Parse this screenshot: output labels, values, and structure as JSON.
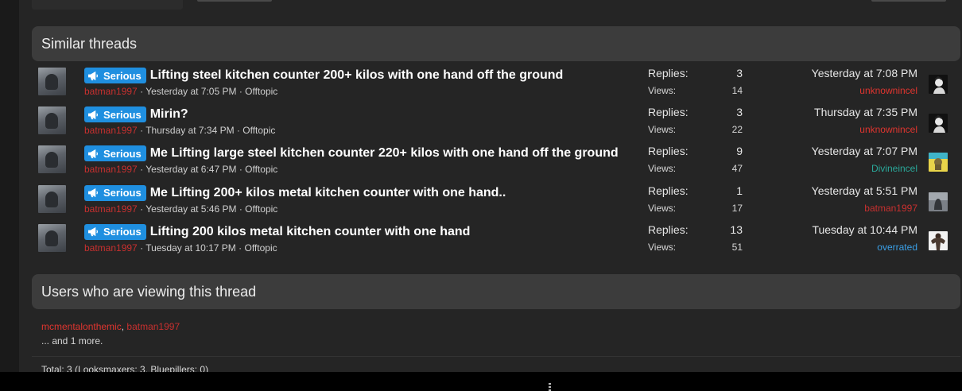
{
  "similar": {
    "heading": "Similar threads",
    "threads": [
      {
        "prefix": "Serious",
        "title": "Lifting steel kitchen counter 200+ kilos with one hand off the ground",
        "author": "batman1997",
        "when": "Yesterday at 7:05 PM",
        "forum": "Offtopic",
        "replies_label": "Replies:",
        "replies": "3",
        "views_label": "Views:",
        "views": "14",
        "last_date": "Yesterday at 7:08 PM",
        "last_user": "unknownincel",
        "last_user_color": "#e0352f",
        "last_avatar": "dark"
      },
      {
        "prefix": "Serious",
        "title": "Mirin?",
        "author": "batman1997",
        "when": "Thursday at 7:34 PM",
        "forum": "Offtopic",
        "replies_label": "Replies:",
        "replies": "3",
        "views_label": "Views:",
        "views": "22",
        "last_date": "Thursday at 7:35 PM",
        "last_user": "unknownincel",
        "last_user_color": "#e0352f",
        "last_avatar": "dark"
      },
      {
        "prefix": "Serious",
        "title": "Me Lifting large steel kitchen counter 220+ kilos with one hand off the ground",
        "author": "batman1997",
        "when": "Yesterday at 6:47 PM",
        "forum": "Offtopic",
        "replies_label": "Replies:",
        "replies": "9",
        "views_label": "Views:",
        "views": "47",
        "last_date": "Yesterday at 7:07 PM",
        "last_user": "Divineincel",
        "last_user_color": "#2aa89a",
        "last_avatar": "yellow"
      },
      {
        "prefix": "Serious",
        "title": "Me Lifting 200+ kilos metal kitchen counter with one hand..",
        "author": "batman1997",
        "when": "Yesterday at 5:46 PM",
        "forum": "Offtopic",
        "replies_label": "Replies:",
        "replies": "1",
        "views_label": "Views:",
        "views": "17",
        "last_date": "Yesterday at 5:51 PM",
        "last_user": "batman1997",
        "last_user_color": "#c8302f",
        "last_avatar": "grey"
      },
      {
        "prefix": "Serious",
        "title": "Lifting 200 kilos metal kitchen counter with one hand",
        "author": "batman1997",
        "when": "Tuesday at 10:17 PM",
        "forum": "Offtopic",
        "replies_label": "Replies:",
        "replies": "13",
        "views_label": "Views:",
        "views": "51",
        "last_date": "Tuesday at 10:44 PM",
        "last_user": "overrated",
        "last_user_color": "#3aa0e8",
        "last_avatar": "muscle"
      }
    ]
  },
  "viewers": {
    "heading": "Users who are viewing this thread",
    "user1": "mcmentalonthemic",
    "separator": ", ",
    "user2": "batman1997",
    "more": "... and 1 more.",
    "total": "Total: 3 (Looksmaxers: 3, Bluepillers: 0)"
  },
  "colors": {
    "prefix_bg": "#1f8fe0",
    "author": "#c8302f"
  },
  "icons": {
    "prefix_icon": "megaphone-icon"
  }
}
